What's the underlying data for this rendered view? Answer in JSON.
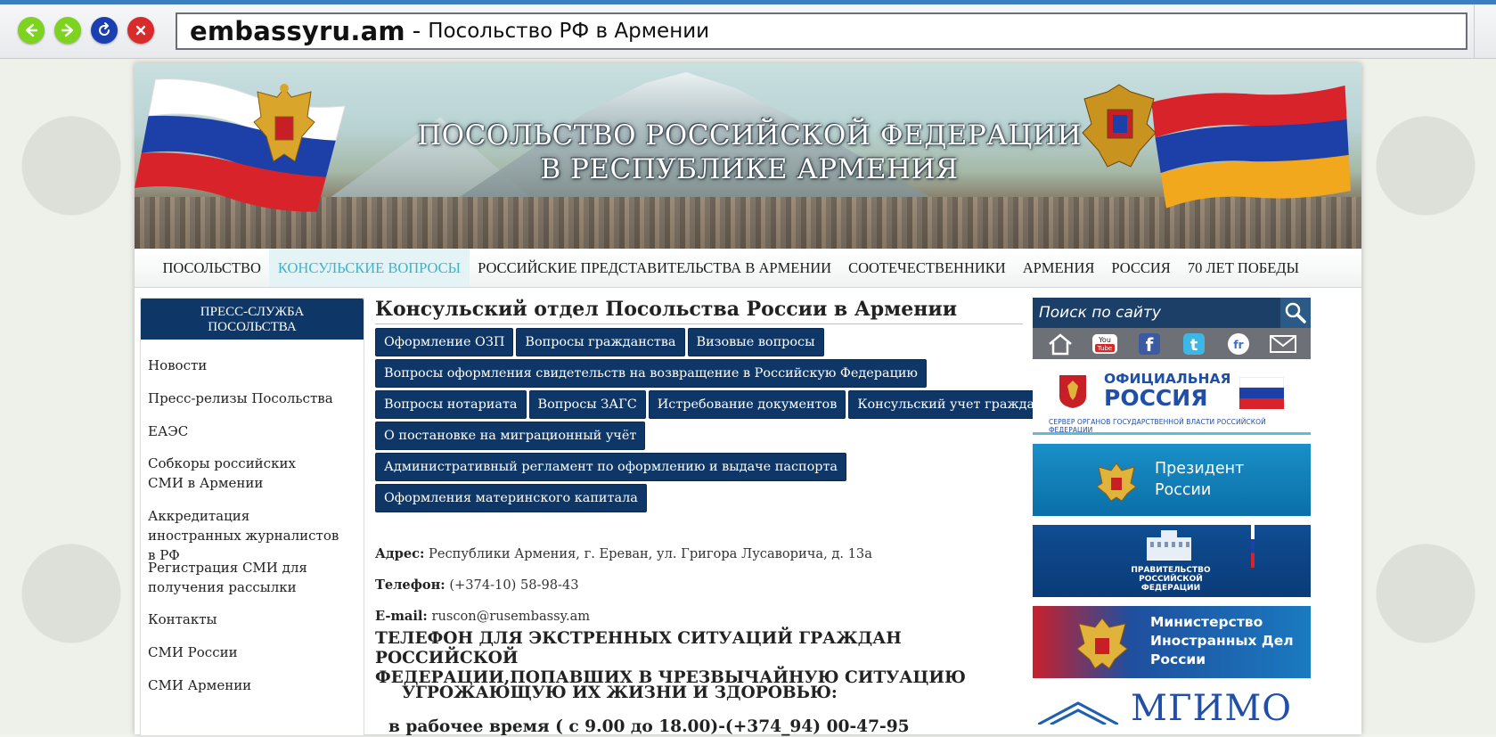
{
  "browser": {
    "url_domain": "embassyru.am",
    "url_separator": "-",
    "page_title": "Посольство РФ в Армении"
  },
  "banner": {
    "title_line1": "ПОСОЛЬСТВО РОССИЙСКОЙ ФЕДЕРАЦИИ",
    "title_line2": "В РЕСПУБЛИКЕ АРМЕНИЯ"
  },
  "topnav": {
    "items": [
      {
        "label": "ПОСОЛЬСТВО"
      },
      {
        "label": "КОНСУЛЬСКИЕ ВОПРОСЫ",
        "active": true
      },
      {
        "label": "РОССИЙСКИЕ ПРЕДСТАВИТЕЛЬСТВА В АРМЕНИИ"
      },
      {
        "label": "СООТЕЧЕСТВЕННИКИ"
      },
      {
        "label": "АРМЕНИЯ"
      },
      {
        "label": "РОССИЯ"
      },
      {
        "label": "70 ЛЕТ ПОБЕДЫ"
      }
    ]
  },
  "sidebar": {
    "header_line1": "ПРЕСС-СЛУЖБА",
    "header_line2": "ПОСОЛЬСТВА",
    "items": [
      {
        "label": "Новости"
      },
      {
        "label": "Пресс-релизы Посольства"
      },
      {
        "label": "ЕАЭС"
      },
      {
        "label": "Собкоры российских СМИ в Армении"
      },
      {
        "label": "Аккредитация иностранных журналистов в РФ"
      },
      {
        "label": "Регистрация СМИ для получения рассылки"
      },
      {
        "label": "Контакты"
      },
      {
        "label": "СМИ России"
      },
      {
        "label": "СМИ Армении"
      }
    ]
  },
  "main": {
    "title": "Консульский отдел Посольства России в Армении",
    "tabs": [
      [
        "Оформление ОЗП",
        "Вопросы гражданства",
        "Визовые вопросы"
      ],
      [
        "Вопросы оформления свидетельств на возвращение в Российскую Федерацию"
      ],
      [
        "Вопросы нотариата",
        "Вопросы ЗАГС",
        "Истребование документов",
        "Консульский учет граждан РФ"
      ],
      [
        "О постановке на миграционный учёт"
      ],
      [
        "Административный регламент по оформлению и выдаче паспорта"
      ],
      [
        "Оформления материнского капитала"
      ]
    ],
    "address_label": "Адрес:",
    "address_value": "Республики Армения, г. Ереван, ул. Григора Лусаворича, д. 13а",
    "phone_label": "Телефон:",
    "phone_value": "(+374-10) 58-98-43",
    "email_label": "E-mail:",
    "email_value": "ruscon@rusembassy.am",
    "emergency_line1": "ТЕЛЕФОН ДЛЯ ЭКСТРЕННЫХ СИТУАЦИЙ ГРАЖДАН РОССИЙСКОЙ",
    "emergency_line2": "ФЕДЕРАЦИИ,ПОПАВШИХ В ЧРЕЗВЫЧАЙНУЮ СИТУАЦИЮ",
    "emergency_line3": "УГРОЖАЮЩУЮ ИХ ЖИЗНИ И ЗДОРОВЬЮ:",
    "emergency_line4": "в рабочее время ( с 9.00 до 18.00)-(+374_94) 00-47-95"
  },
  "right": {
    "search_label": "Поиск по сайту",
    "social_icons": [
      "home-icon",
      "youtube-icon",
      "facebook-icon",
      "twitter-icon",
      "friendfeed-icon",
      "mail-icon"
    ],
    "youtube_text": "You Tube",
    "ofr_line1": "ОФИЦИАЛЬНАЯ",
    "ofr_line2": "РОССИЯ",
    "ofr_small": "СЕРВЕР ОРГАНОВ ГОСУДАРСТВЕННОЙ ВЛАСТИ РОССИЙСКОЙ ФЕДЕРАЦИИ",
    "pres_line1": "Президент",
    "pres_line2": "России",
    "gov_line1": "ПРАВИТЕЛЬСТВО",
    "gov_line2": "РОССИЙСКОЙ",
    "gov_line3": "ФЕДЕРАЦИИ",
    "mid_line1": "Министерство",
    "mid_line2": "Иностранных Дел",
    "mid_line3": "России",
    "mgimo_text": "МГИМО"
  },
  "colors": {
    "navy": "#0e3767",
    "active_nav": "#3fb4c8",
    "chrome_accent": "#3b7fc0"
  }
}
